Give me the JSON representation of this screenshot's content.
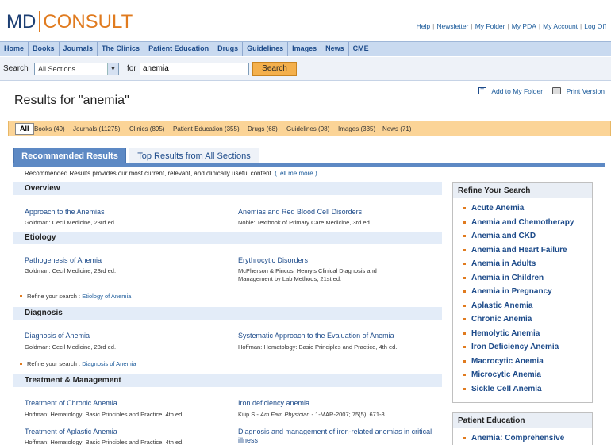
{
  "header": {
    "logo_md": "MD",
    "logo_consult": "CONSULT",
    "links": [
      "Help",
      "Newsletter",
      "My Folder",
      "My PDA",
      "My Account",
      "Log Off"
    ]
  },
  "nav": [
    "Home",
    "Books",
    "Journals",
    "The Clinics",
    "Patient Education",
    "Drugs",
    "Guidelines",
    "Images",
    "News",
    "CME"
  ],
  "search": {
    "label": "Search",
    "section_value": "All Sections",
    "for_label": "for",
    "query": "anemia",
    "button": "Search"
  },
  "results_title": "Results for \"anemia\"",
  "actions": {
    "folder": "Add to My Folder",
    "print": "Print Version"
  },
  "categories": {
    "all": "All",
    "items": [
      "Books (49)",
      "Journals (11275)",
      "Clinics (895)",
      "Patient Education (355)",
      "Drugs (68)",
      "Guidelines (98)",
      "Images (335)",
      "News (71)"
    ]
  },
  "tabs": {
    "recommended": "Recommended Results",
    "top": "Top Results from All Sections"
  },
  "rec_desc": "Recommended Results provides our most current, relevant, and clinically useful content.",
  "rec_desc_link": "(Tell me more.)",
  "sections": {
    "overview": {
      "title": "Overview",
      "r1": {
        "title": "Approach to the Anemias",
        "src": "Goldman: Cecil Medicine, 23rd ed."
      },
      "r2": {
        "title": "Anemias and Red Blood Cell Disorders",
        "src": "Noble: Textbook of Primary Care Medicine, 3rd ed."
      }
    },
    "etiology": {
      "title": "Etiology",
      "r1": {
        "title": "Pathogenesis of Anemia",
        "src": "Goldman: Cecil Medicine, 23rd ed."
      },
      "r2": {
        "title": "Erythrocytic Disorders",
        "src": "McPherson & Pincus: Henry's Clinical Diagnosis and Management by Lab Methods, 21st ed."
      },
      "refine_label": "Refine your search :",
      "refine_link": "Etiology of Anemia"
    },
    "diagnosis": {
      "title": "Diagnosis",
      "r1": {
        "title": "Diagnosis of Anemia",
        "src": "Goldman: Cecil Medicine, 23rd ed."
      },
      "r2": {
        "title": "Systematic Approach to the Evaluation of Anemia",
        "src": "Hoffman: Hematology: Basic Principles and Practice, 4th ed."
      },
      "refine_label": "Refine your search :",
      "refine_link": "Diagnosis of Anemia"
    },
    "treatment": {
      "title": "Treatment & Management",
      "r1": {
        "title": "Treatment of Chronic Anemia",
        "src": "Hoffman: Hematology: Basic Principles and Practice, 4th ed."
      },
      "r2": {
        "title": "Iron deficiency anemia",
        "src_author": "Kilip S - ",
        "src_journal": "Am Fam Physician",
        "src_rest": " - 1-MAR-2007; 75(5): 671-8"
      },
      "r3": {
        "title": "Treatment of Aplastic Anemia",
        "src": "Hoffman: Hematology: Basic Principles and Practice, 4th ed."
      },
      "r4": {
        "title": "Diagnosis and management of iron-related anemias in critical illness"
      }
    }
  },
  "refine_panel": {
    "title": "Refine Your Search",
    "items": [
      "Acute Anemia",
      "Anemia and Chemotherapy",
      "Anemia and CKD",
      "Anemia and Heart Failure",
      "Anemia in Adults",
      "Anemia in Children",
      "Anemia in Pregnancy",
      "Aplastic Anemia",
      "Chronic Anemia",
      "Hemolytic Anemia",
      "Iron Deficiency Anemia",
      "Macrocytic Anemia",
      "Microcytic Anemia",
      "Sickle Cell Anemia"
    ]
  },
  "patient_panel": {
    "title": "Patient Education",
    "items": [
      "Anemia: Comprehensive"
    ]
  }
}
